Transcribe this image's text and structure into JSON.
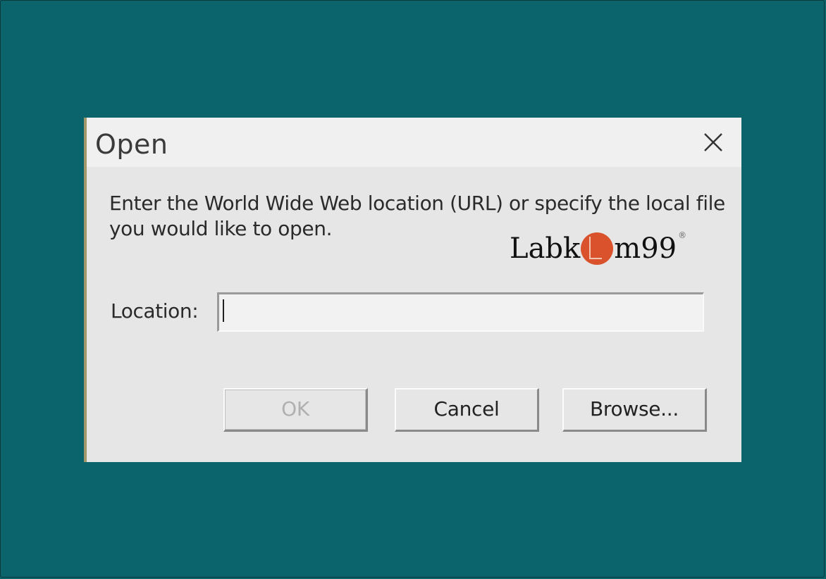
{
  "dialog": {
    "title": "Open",
    "message_line1": "Enter the World Wide Web location (URL) or specify the local file",
    "message_line2": "you would like to open.",
    "location_label": "Location:",
    "location_value": "",
    "buttons": {
      "ok": "OK",
      "ok_enabled": false,
      "cancel": "Cancel",
      "browse": "Browse..."
    }
  },
  "watermark": {
    "text_before": "Labk",
    "text_after": "m99",
    "registered_mark": "®",
    "accent_color": "#d9522c"
  },
  "icons": {
    "close": "close-icon",
    "watermark_logo": "labkom-logo-icon"
  },
  "colors": {
    "desktop_background": "#0b646b",
    "dialog_background": "#e6e6e6",
    "titlebar_background": "#f0f0f0",
    "disabled_text": "#b0b0b0"
  }
}
